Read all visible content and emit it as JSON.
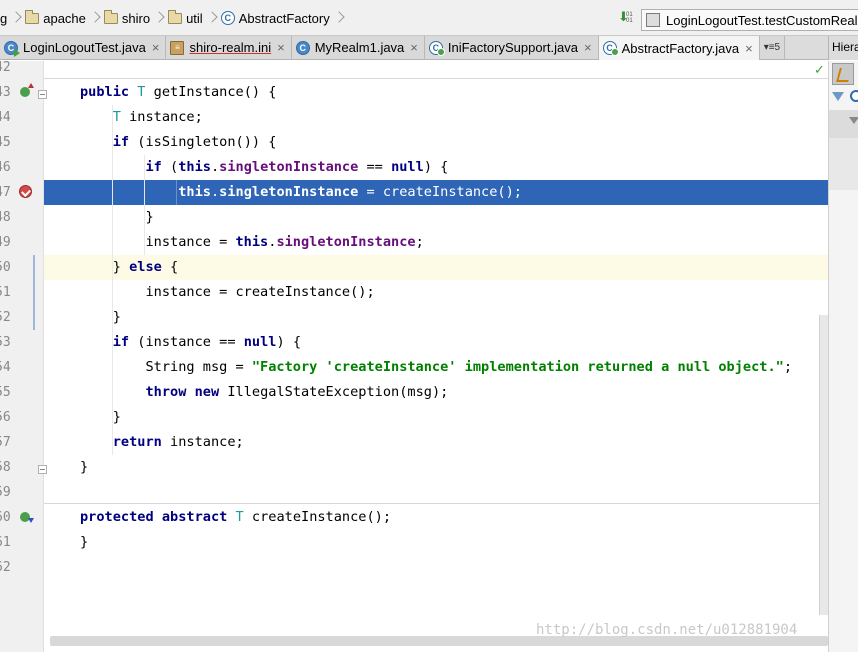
{
  "breadcrumb": [
    {
      "label": "g",
      "icon": "none"
    },
    {
      "label": "apache",
      "icon": "folder-icon"
    },
    {
      "label": "shiro",
      "icon": "folder-icon"
    },
    {
      "label": "util",
      "icon": "folder-icon"
    },
    {
      "label": "AbstractFactory",
      "icon": "class-icon"
    }
  ],
  "toolbar": {
    "vcs_bits": "01\n01",
    "run_config": "LoginLogoutTest.testCustomRealm"
  },
  "tabs": [
    {
      "label": "LoginLogoutTest.java",
      "icon": "test-class-icon",
      "close": "×",
      "active": false
    },
    {
      "label": "shiro-realm.ini",
      "icon": "ini-file-icon",
      "close": "×",
      "active": false
    },
    {
      "label": "MyRealm1.java",
      "icon": "class-icon",
      "close": "×",
      "active": false
    },
    {
      "label": "IniFactorySupport.java",
      "icon": "abstract-class-icon",
      "close": "×",
      "active": false
    },
    {
      "label": "AbstractFactory.java",
      "icon": "abstract-class-icon",
      "close": "×",
      "active": true
    }
  ],
  "tabs_overflow": "5",
  "side_panel": {
    "title": "Hiera"
  },
  "editor": {
    "lines": [
      {
        "num": "42",
        "code": ""
      },
      {
        "num": "43",
        "code": "public T getInstance() {"
      },
      {
        "num": "44",
        "code": "    T instance;"
      },
      {
        "num": "45",
        "code": "    if (isSingleton()) {"
      },
      {
        "num": "46",
        "code": "        if (this.singletonInstance == null) {"
      },
      {
        "num": "47",
        "code": "            this.singletonInstance = createInstance();"
      },
      {
        "num": "48",
        "code": "        }"
      },
      {
        "num": "49",
        "code": "        instance = this.singletonInstance;"
      },
      {
        "num": "50",
        "code": "    } else {"
      },
      {
        "num": "51",
        "code": "        instance = createInstance();"
      },
      {
        "num": "52",
        "code": "    }"
      },
      {
        "num": "53",
        "code": "    if (instance == null) {"
      },
      {
        "num": "54",
        "code": "        String msg = \"Factory 'createInstance' implementation returned a null object.\";"
      },
      {
        "num": "55",
        "code": "        throw new IllegalStateException(msg);"
      },
      {
        "num": "56",
        "code": "    }"
      },
      {
        "num": "57",
        "code": "    return instance;"
      },
      {
        "num": "58",
        "code": "}"
      },
      {
        "num": "59",
        "code": ""
      },
      {
        "num": "60",
        "code": "protected abstract T createInstance();"
      },
      {
        "num": "61",
        "code": "}"
      },
      {
        "num": "62",
        "code": ""
      }
    ],
    "selected_line": "47",
    "caret_line": "50"
  },
  "watermark": "http://blog.csdn.net/u012881904",
  "colors": {
    "keyword": "#000080",
    "type_param": "#20999d",
    "field": "#660e7a",
    "string": "#008000",
    "selection": "#2f65b7",
    "caret_row": "#fdfae6",
    "breakpoint": "#d04a4a"
  }
}
